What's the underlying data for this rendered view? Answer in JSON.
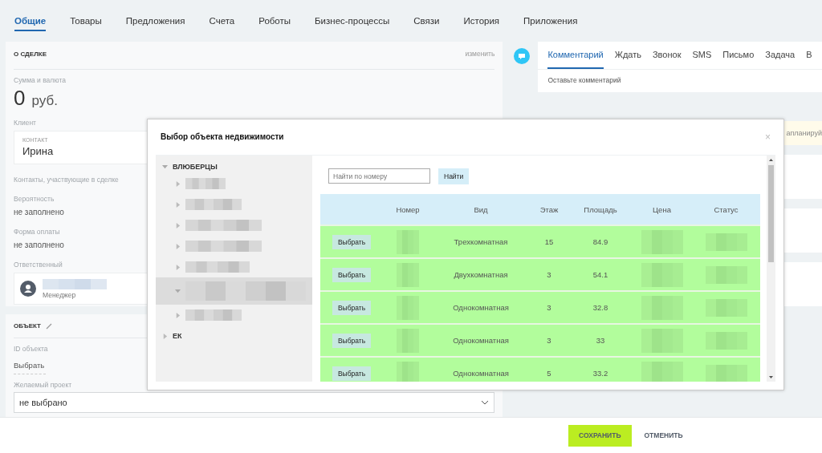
{
  "tabs": [
    {
      "label": "Общие",
      "selected": true
    },
    {
      "label": "Товары",
      "selected": false
    },
    {
      "label": "Предложения",
      "selected": false
    },
    {
      "label": "Счета",
      "selected": false
    },
    {
      "label": "Роботы",
      "selected": false
    },
    {
      "label": "Бизнес-процессы",
      "selected": false
    },
    {
      "label": "Связи",
      "selected": false
    },
    {
      "label": "История",
      "selected": false
    },
    {
      "label": "Приложения",
      "selected": false
    }
  ],
  "deal": {
    "title": "О СДЕЛКЕ",
    "edit_link": "изменить",
    "amount_label": "Сумма и валюта",
    "amount": "0",
    "currency": "руб.",
    "client_label": "Клиент",
    "contact_caption": "КОНТАКТ",
    "contact_name": "Ирина",
    "contacts_label": "Контакты, участвующие в сделке",
    "fields": [
      {
        "label": "Вероятность",
        "value": "не заполнено"
      },
      {
        "label": "Форма оплаты",
        "value": "не заполнено"
      }
    ],
    "responsible_label": "Ответственный",
    "responsible_role": "Менеджер"
  },
  "object": {
    "title": "ОБЪЕКТ",
    "id_label": "ID объекта",
    "id_link": "Выбрать",
    "project_label": "Желаемый проект",
    "project_value": "не выбрано"
  },
  "activity": {
    "tabs": [
      {
        "label": "Комментарий",
        "selected": true
      },
      {
        "label": "Ждать",
        "selected": false
      },
      {
        "label": "Звонок",
        "selected": false
      },
      {
        "label": "SMS",
        "selected": false
      },
      {
        "label": "Письмо",
        "selected": false
      },
      {
        "label": "Задача",
        "selected": false
      },
      {
        "label": "В",
        "selected": false
      }
    ],
    "placeholder": "Оставьте комментарий",
    "notice": "апланируй"
  },
  "modal": {
    "title": "Выбор объекта недвижимости",
    "close": "×",
    "tree": [
      {
        "label": "ВЛЮБЕРЦЫ",
        "expanded": true,
        "children": [
          {
            "kind": "redacted",
            "expanded": false,
            "selected": false
          },
          {
            "kind": "redacted",
            "expanded": false,
            "selected": false
          },
          {
            "kind": "redacted",
            "expanded": false,
            "selected": false
          },
          {
            "kind": "redacted",
            "expanded": false,
            "selected": false
          },
          {
            "kind": "redacted",
            "expanded": false,
            "selected": false
          },
          {
            "kind": "redacted",
            "expanded": true,
            "selected": true
          },
          {
            "kind": "redacted",
            "expanded": false,
            "selected": false
          }
        ]
      },
      {
        "label": "ЕК",
        "expanded": false
      }
    ],
    "search": {
      "placeholder": "Найти по номеру",
      "button": "Найти"
    },
    "table": {
      "columns": [
        "Номер",
        "Вид",
        "Этаж",
        "Площадь",
        "Цена",
        "Статус"
      ],
      "rows": [
        {
          "button": "Выбрать",
          "type": "Трехкомнатная",
          "floor": "15",
          "area": "84.9"
        },
        {
          "button": "Выбрать",
          "type": "Двухкомнатная",
          "floor": "3",
          "area": "54.1"
        },
        {
          "button": "Выбрать",
          "type": "Однокомнатная",
          "floor": "3",
          "area": "32.8"
        },
        {
          "button": "Выбрать",
          "type": "Однокомнатная",
          "floor": "3",
          "area": "33"
        },
        {
          "button": "Выбрать",
          "type": "Однокомнатная",
          "floor": "5",
          "area": "33.2"
        }
      ]
    }
  },
  "footer": {
    "save": "СОХРАНИТЬ",
    "cancel": "ОТМЕНИТЬ"
  }
}
